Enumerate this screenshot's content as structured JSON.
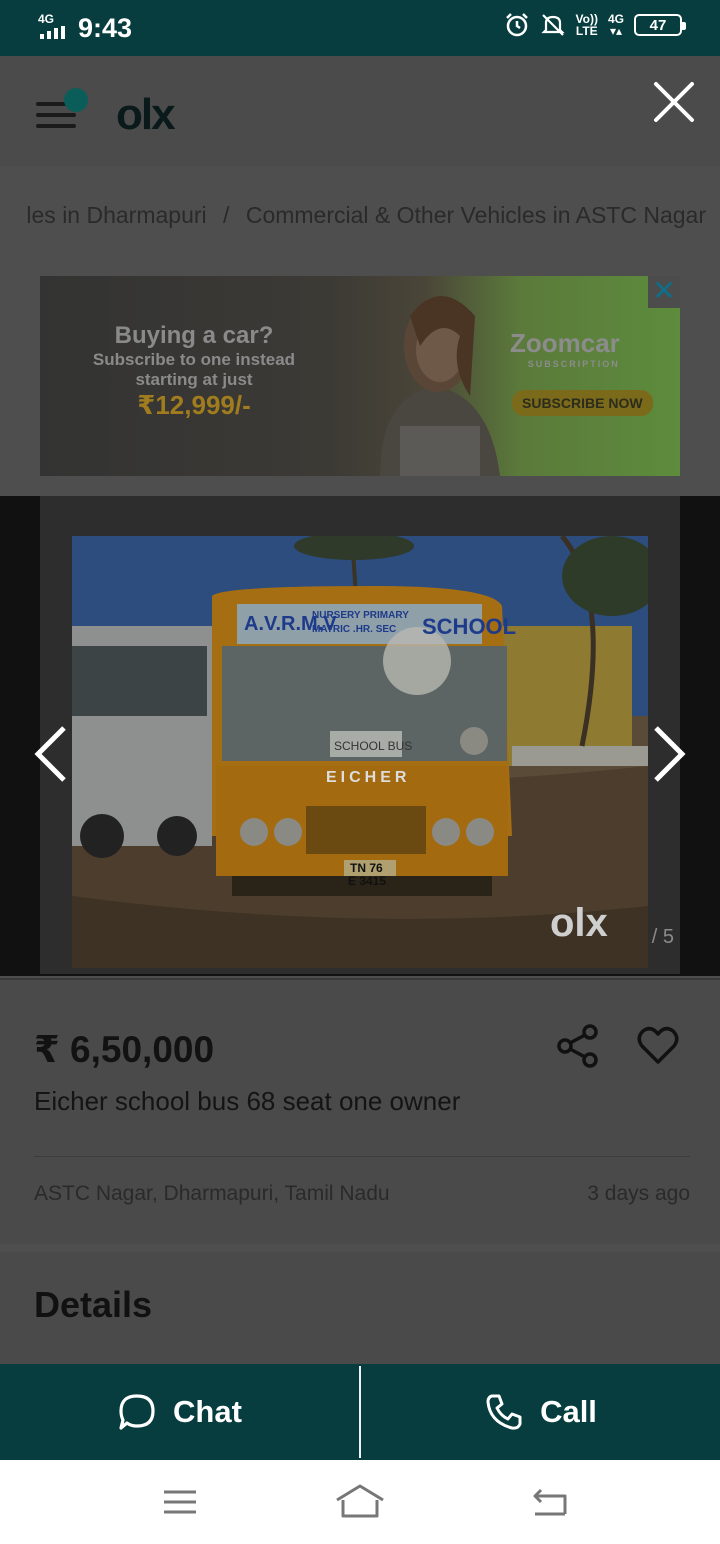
{
  "status_bar": {
    "network": "4G",
    "time": "9:43",
    "volte": "Vo))",
    "lte_top": "4G",
    "lte_bottom": "LTE",
    "battery": "47",
    "accent": "#073d3e"
  },
  "header": {
    "logo": "olx",
    "menu_icon": "hamburger-icon",
    "close_icon": "close-icon"
  },
  "breadcrumb": {
    "items": [
      "les in Dharmapuri",
      "Commercial & Other Vehicles in ASTC Nagar"
    ],
    "separator": "/"
  },
  "ad": {
    "headline": "Buying a car?",
    "line1": "Subscribe to one instead",
    "line2": "starting at just",
    "price": "₹12,999/-",
    "brand": "Zoomcar",
    "brand_sub": "SUBSCRIPTION",
    "cta": "SUBSCRIBE NOW",
    "close": "✕"
  },
  "gallery": {
    "counter": "/ 5",
    "watermark": "olx",
    "bus_header_left": "A.V.R.M.V",
    "bus_header_mid1": "NURSERY PRIMARY",
    "bus_header_mid2": "MATRIC .HR. SEC",
    "bus_header_right": "SCHOOL",
    "bus_brand": "EICHER",
    "bus_sign": "SCHOOL BUS",
    "plate_line1": "TN 76",
    "plate_line2": "E 3415"
  },
  "listing": {
    "price": "₹ 6,50,000",
    "title": "Eicher school bus 68 seat one owner",
    "location": "ASTC Nagar, Dharmapuri, Tamil Nadu",
    "posted": "3 days ago"
  },
  "details": {
    "heading": "Details"
  },
  "actions": {
    "chat_label": "Chat",
    "call_label": "Call",
    "chat_icon": "chat-bubble-icon",
    "call_icon": "phone-icon"
  }
}
